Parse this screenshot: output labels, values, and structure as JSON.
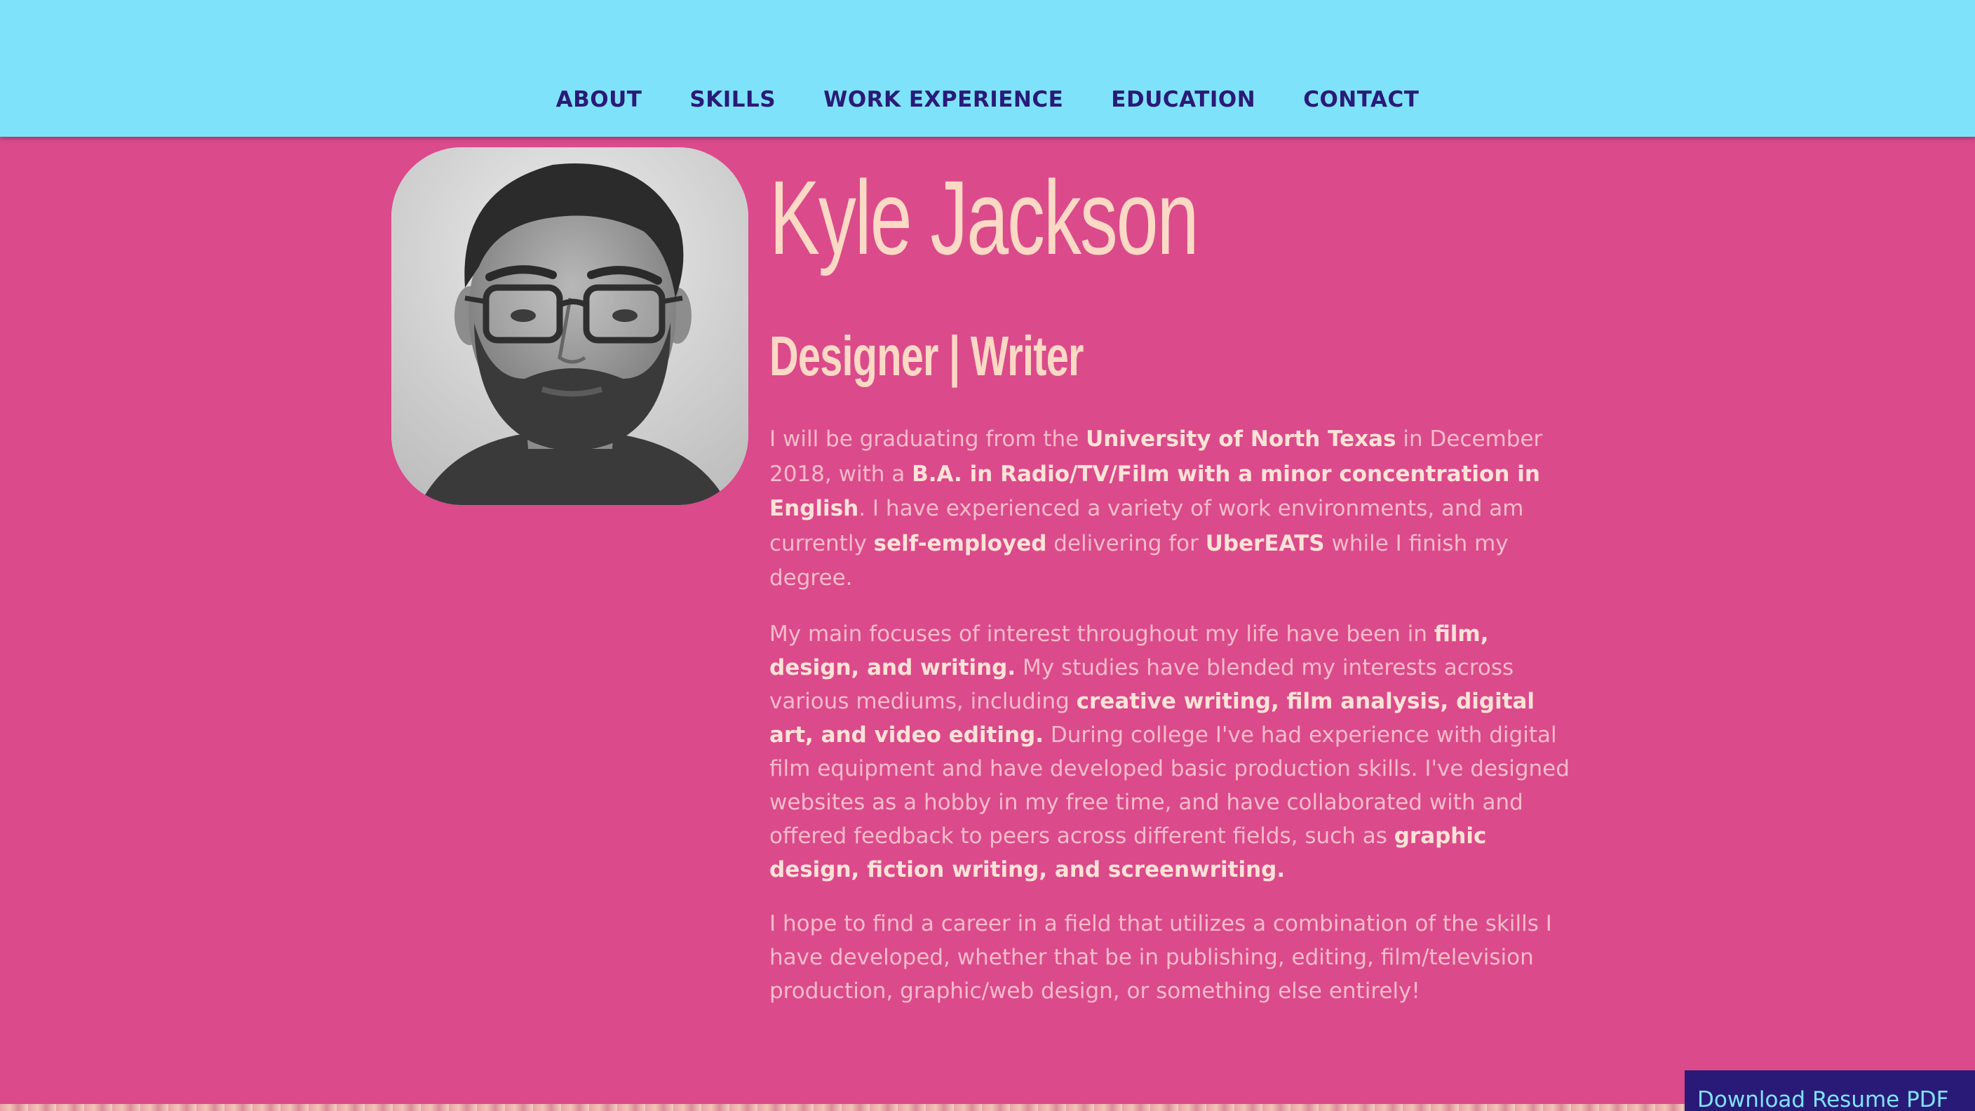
{
  "nav": {
    "items": [
      {
        "label": "ABOUT"
      },
      {
        "label": "SKILLS"
      },
      {
        "label": "WORK EXPERIENCE"
      },
      {
        "label": "EDUCATION"
      },
      {
        "label": "CONTACT"
      }
    ]
  },
  "profile": {
    "name": "Kyle Jackson",
    "title": "Designer | Writer"
  },
  "about": {
    "p1": {
      "t1": "I will be graduating from the ",
      "b1": "University of North Texas",
      "t2": " in December 2018, with a ",
      "b2": "B.A. in Radio/TV/Film with a minor concentration in English",
      "t3": ". I have experienced a variety of work environments, and am currently ",
      "b3": "self-employed",
      "t4": " delivering for ",
      "b4": "UberEATS",
      "t5": " while I finish my degree."
    },
    "p2": {
      "t1": "My main focuses of interest throughout my life have been in ",
      "b1": "film, design, and writing.",
      "t2": " My studies have blended my interests across various mediums, including ",
      "b2": "creative writing, film analysis, digital art, and video editing.",
      "t3": " During college I've had experience with digital film equipment and have developed basic production skills. I've designed websites as a hobby in my free time, and have collaborated with and offered feedback to peers across different fields, such as ",
      "b3": "graphic design, fiction writing, and screenwriting."
    },
    "p3": {
      "t1": "I hope to find a career in a field that utilizes a combination of the skills I have developed, whether that be in publishing, editing, film/television production, graphic/web design, or something else entirely!"
    }
  },
  "download": {
    "label": "Download Resume PDF"
  },
  "colors": {
    "background": "#db4a8b",
    "navbar": "#7ee3fa",
    "nav_text": "#2a1a78",
    "heading": "#fbd9c4",
    "body_text": "#f6bcc9",
    "bold_text": "#fde3d6",
    "button_bg": "#2a1a78",
    "button_text": "#7ee3fa"
  },
  "icons": {
    "photo": "portrait-photo"
  }
}
